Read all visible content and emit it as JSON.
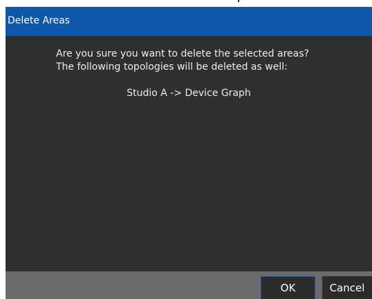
{
  "dialog": {
    "title": "Delete Areas",
    "message_line1": "Are you sure you want to delete the selected areas?",
    "message_line2": "The following topologies will be deleted as well:",
    "topology_item": "Studio A -> Device Graph",
    "ok_label": "OK",
    "cancel_label": "Cancel"
  },
  "colors": {
    "titlebar": "#0f57a9",
    "body": "#2f2f2f",
    "footer": "#6b6b6b",
    "button": "#2c2c2c",
    "text": "#ededed"
  }
}
